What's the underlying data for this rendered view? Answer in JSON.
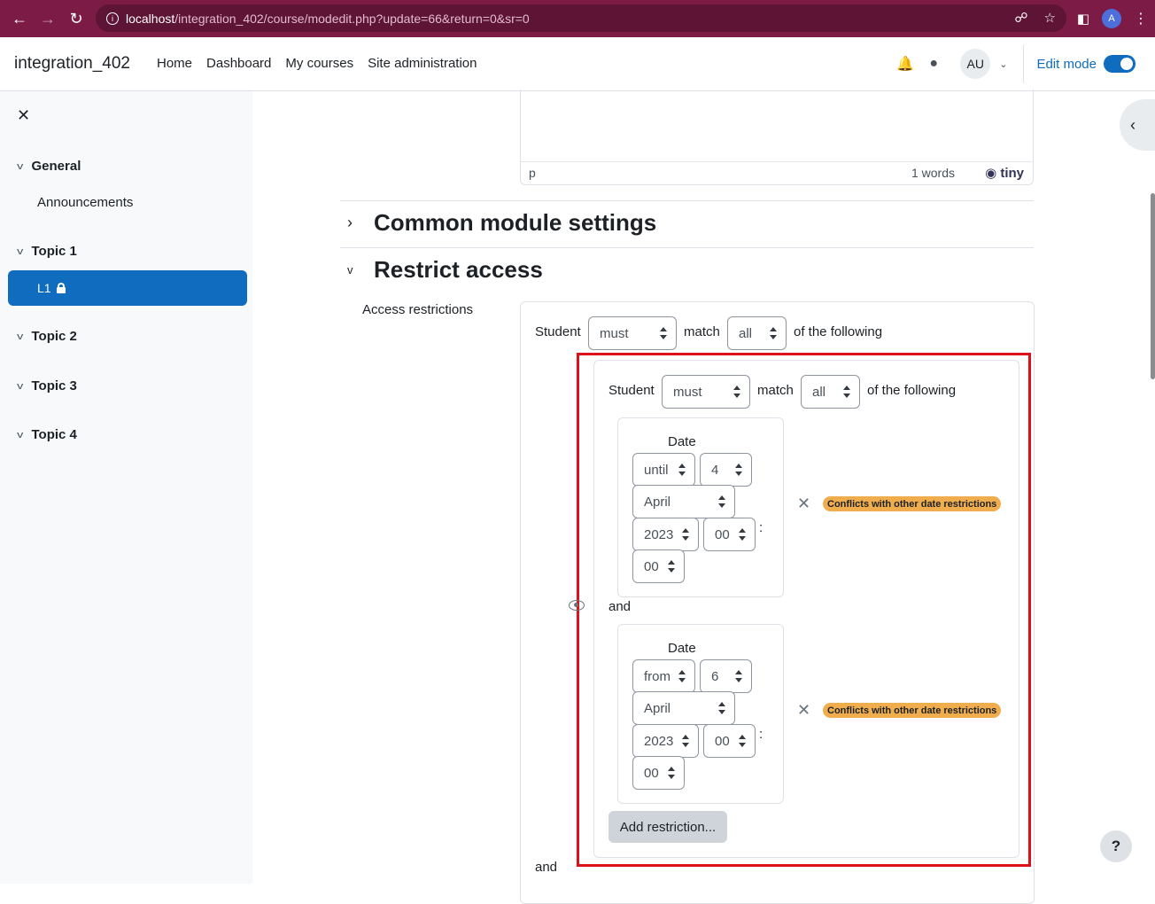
{
  "browser": {
    "url_host": "localhost",
    "url_path": "/integration_402/course/modedit.php?update=66&return=0&sr=0",
    "profile_initial": "A"
  },
  "navbar": {
    "site_name": "integration_402",
    "links": [
      "Home",
      "Dashboard",
      "My courses",
      "Site administration"
    ],
    "user_initials": "AU",
    "edit_mode_label": "Edit mode",
    "edit_mode_on": true
  },
  "drawer": {
    "sections": [
      {
        "label": "General",
        "items": [
          "Announcements"
        ]
      },
      {
        "label": "Topic 1",
        "items": [
          "L1"
        ]
      },
      {
        "label": "Topic 2",
        "items": []
      },
      {
        "label": "Topic 3",
        "items": []
      },
      {
        "label": "Topic 4",
        "items": []
      }
    ],
    "active_item": "L1"
  },
  "editor": {
    "element_path": "p",
    "word_count": "1 words",
    "brand": "tiny"
  },
  "sections": {
    "common": "Common module settings",
    "restrict": "Restrict access"
  },
  "restrict": {
    "field_label": "Access restrictions",
    "outer": {
      "prefix": "Student",
      "must": "must",
      "match": "match",
      "all": "all",
      "suffix": "of the following"
    },
    "inner": {
      "prefix": "Student",
      "must": "must",
      "match": "match",
      "all": "all",
      "suffix": "of the following"
    },
    "conditions": [
      {
        "type_label": "Date",
        "direction": "until",
        "day": "4",
        "month": "April",
        "year": "2023",
        "hour": "00",
        "minute": "00",
        "time_sep": ":",
        "warning": "Conflicts with other date restrictions"
      },
      {
        "type_label": "Date",
        "direction": "from",
        "day": "6",
        "month": "April",
        "year": "2023",
        "hour": "00",
        "minute": "00",
        "time_sep": ":",
        "warning": "Conflicts with other date restrictions"
      }
    ],
    "joiner": "and",
    "add_restriction": "Add restriction...",
    "outer_joiner": "and"
  },
  "help_label": "?"
}
